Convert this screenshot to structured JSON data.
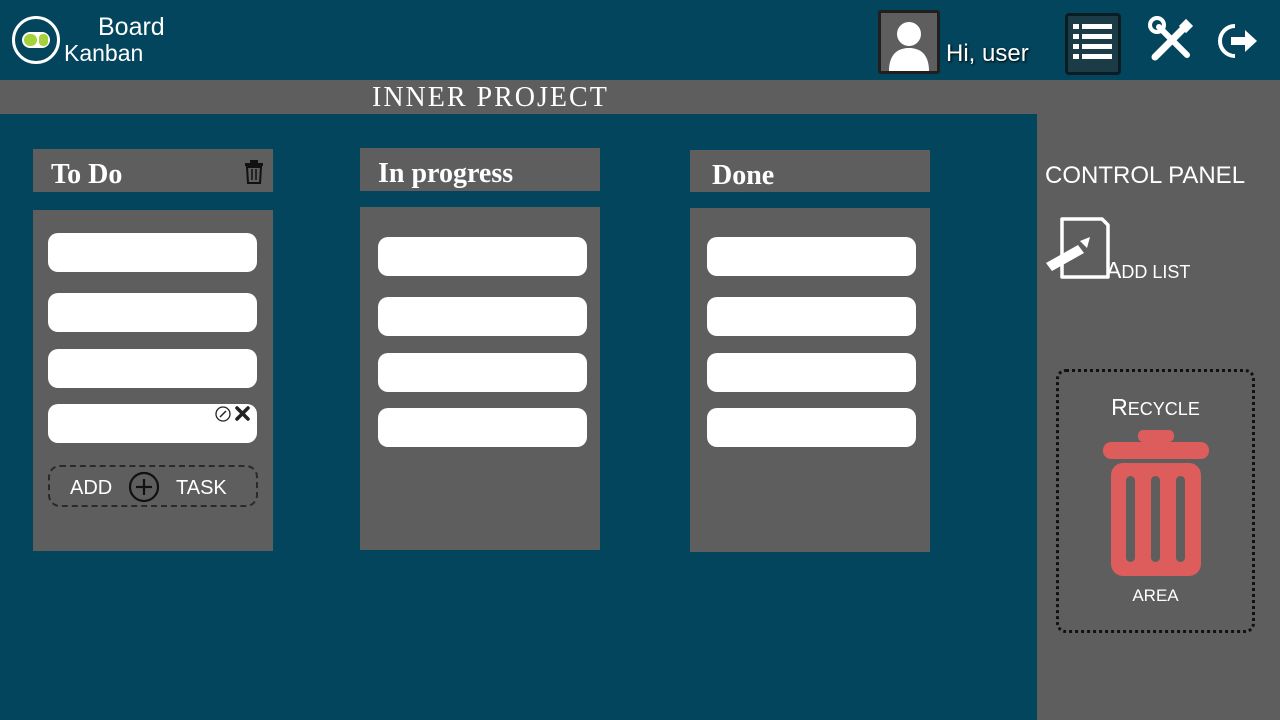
{
  "header": {
    "logo_top": "Board",
    "logo_bottom": "Kanban",
    "greeting": "Hi, user",
    "logo_icon": "toggle-logo-icon",
    "avatar_icon": "user-avatar-icon",
    "menu_icon": "list-menu-icon",
    "settings_icon": "tools-icon",
    "logout_icon": "logout-icon"
  },
  "project": {
    "title": "INNER PROJECT"
  },
  "lists": [
    {
      "title": "To Do",
      "cards": [
        "",
        "",
        "",
        ""
      ],
      "add_task_left": "ADD",
      "add_task_right": "TASK"
    },
    {
      "title": "In progress",
      "cards": [
        "",
        "",
        "",
        ""
      ]
    },
    {
      "title": "Done",
      "cards": [
        "",
        "",
        "",
        ""
      ]
    }
  ],
  "control_panel": {
    "title": "CONTROL PANEL",
    "add_list_first": "A",
    "add_list_rest": "DD LIST",
    "recycle_first": "R",
    "recycle_rest": "ECYCLE",
    "recycle_area": "AREA"
  },
  "colors": {
    "background": "#02455c",
    "panel": "#5e5e5e",
    "card": "#ffffff",
    "trash": "#dd5c5c",
    "logo_accent": "#a3d23a"
  }
}
